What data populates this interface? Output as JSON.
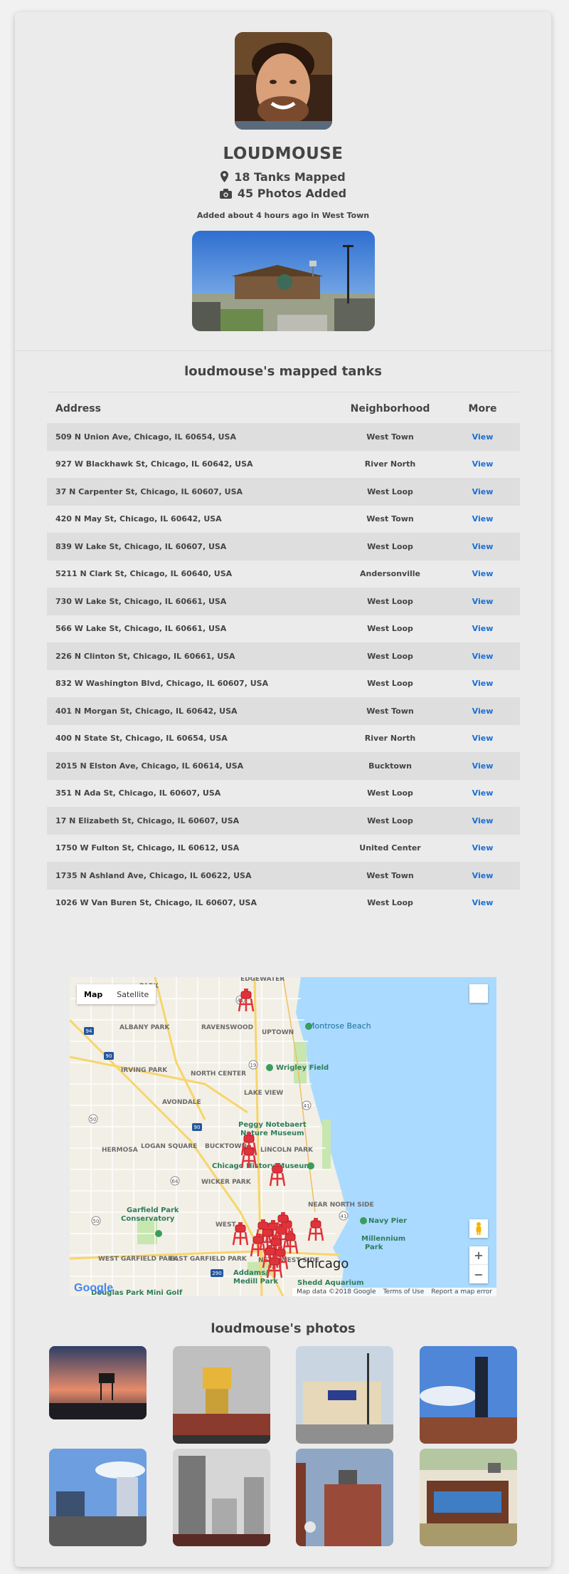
{
  "profile": {
    "username": "LOUDMOUSE",
    "tanks_mapped": "18 Tanks Mapped",
    "photos_added": "45 Photos Added",
    "added_text": "Added about 4 hours ago in West Town"
  },
  "icons": {
    "tanks": "map-marker-icon",
    "photos": "camera-icon"
  },
  "tanks_section": {
    "title": "loudmouse's mapped tanks",
    "headers": {
      "address": "Address",
      "neighborhood": "Neighborhood",
      "more": "More"
    },
    "rows": [
      {
        "address": "509 N Union Ave, Chicago, IL 60654, USA",
        "neighborhood": "West Town",
        "link": "View"
      },
      {
        "address": "927 W Blackhawk St, Chicago, IL 60642, USA",
        "neighborhood": "River North",
        "link": "View"
      },
      {
        "address": "37 N Carpenter St, Chicago, IL 60607, USA",
        "neighborhood": "West Loop",
        "link": "View"
      },
      {
        "address": "420 N May St, Chicago, IL 60642, USA",
        "neighborhood": "West Town",
        "link": "View"
      },
      {
        "address": "839 W Lake St, Chicago, IL 60607, USA",
        "neighborhood": "West Loop",
        "link": "View"
      },
      {
        "address": "5211 N Clark St, Chicago, IL 60640, USA",
        "neighborhood": "Andersonville",
        "link": "View"
      },
      {
        "address": "730 W Lake St, Chicago, IL 60661, USA",
        "neighborhood": "West Loop",
        "link": "View"
      },
      {
        "address": "566 W Lake St, Chicago, IL 60661, USA",
        "neighborhood": "West Loop",
        "link": "View"
      },
      {
        "address": "226 N Clinton St, Chicago, IL 60661, USA",
        "neighborhood": "West Loop",
        "link": "View"
      },
      {
        "address": "832 W Washington Blvd, Chicago, IL 60607, USA",
        "neighborhood": "West Loop",
        "link": "View"
      },
      {
        "address": "401 N Morgan St, Chicago, IL 60642, USA",
        "neighborhood": "West Town",
        "link": "View"
      },
      {
        "address": "400 N State St, Chicago, IL 60654, USA",
        "neighborhood": "River North",
        "link": "View"
      },
      {
        "address": "2015 N Elston Ave, Chicago, IL 60614, USA",
        "neighborhood": "Bucktown",
        "link": "View"
      },
      {
        "address": "351 N Ada St, Chicago, IL 60607, USA",
        "neighborhood": "West Loop",
        "link": "View"
      },
      {
        "address": "17 N Elizabeth St, Chicago, IL 60607, USA",
        "neighborhood": "West Loop",
        "link": "View"
      },
      {
        "address": "1750 W Fulton St, Chicago, IL 60612, USA",
        "neighborhood": "United Center",
        "link": "View"
      },
      {
        "address": "1735 N Ashland Ave, Chicago, IL 60622, USA",
        "neighborhood": "West Town",
        "link": "View"
      },
      {
        "address": "1026 W Van Buren St, Chicago, IL 60607, USA",
        "neighborhood": "West Loop",
        "link": "View"
      }
    ]
  },
  "map": {
    "toggle": [
      "Map",
      "Satellite"
    ],
    "labels": {
      "edgewater": "EDGEWATER",
      "park": "PARK",
      "albany_park": "ALBANY PARK",
      "ravenswood": "RAVENSWOOD",
      "uptown": "UPTOWN",
      "montrose": "Montrose Beach",
      "irving": "IRVING PARK",
      "north_center": "NORTH CENTER",
      "wrigley": "Wrigley Field",
      "lake_view": "LAKE VIEW",
      "avondale": "AVONDALE",
      "nature1": "Peggy Notebaert",
      "nature2": "Nature Museum",
      "hermosa": "HERMOSA",
      "logan": "LOGAN SQUARE",
      "bucktown": "BUCKTOWN",
      "lincoln_park": "LINCOLN PARK",
      "history": "Chicago History Museum",
      "wicker": "WICKER PARK",
      "garfield1": "Garfield Park",
      "garfield2": "Conservatory",
      "west": "WEST",
      "near_north": "NEAR NORTH SIDE",
      "navy_pier": "Navy Pier",
      "millennium1": "Millennium",
      "millennium2": "Park",
      "west_garfield": "WEST GARFIELD PARK",
      "east_garfield": "EAST GARFIELD PARK",
      "near_west": "NEAR WEST SIDE",
      "chicago": "Chicago",
      "addams1": "Addams/",
      "addams2": "Medill Park",
      "shedd": "Shedd Aquarium",
      "douglas": "Douglas Park Mini Golf"
    },
    "road_shields": [
      "41",
      "94",
      "90",
      "19",
      "50",
      "41",
      "90",
      "64",
      "50",
      "41",
      "290"
    ],
    "footer": {
      "data": "Map data ©2018 Google",
      "terms": "Terms of Use",
      "report": "Report a map error"
    },
    "logo": "Google",
    "zoom_in": "+",
    "zoom_out": "−",
    "colors": {
      "water": "#aadaff",
      "marker": "#e0323a",
      "park": "#c8e6b0"
    }
  },
  "photos_section": {
    "title": "loudmouse's photos"
  }
}
